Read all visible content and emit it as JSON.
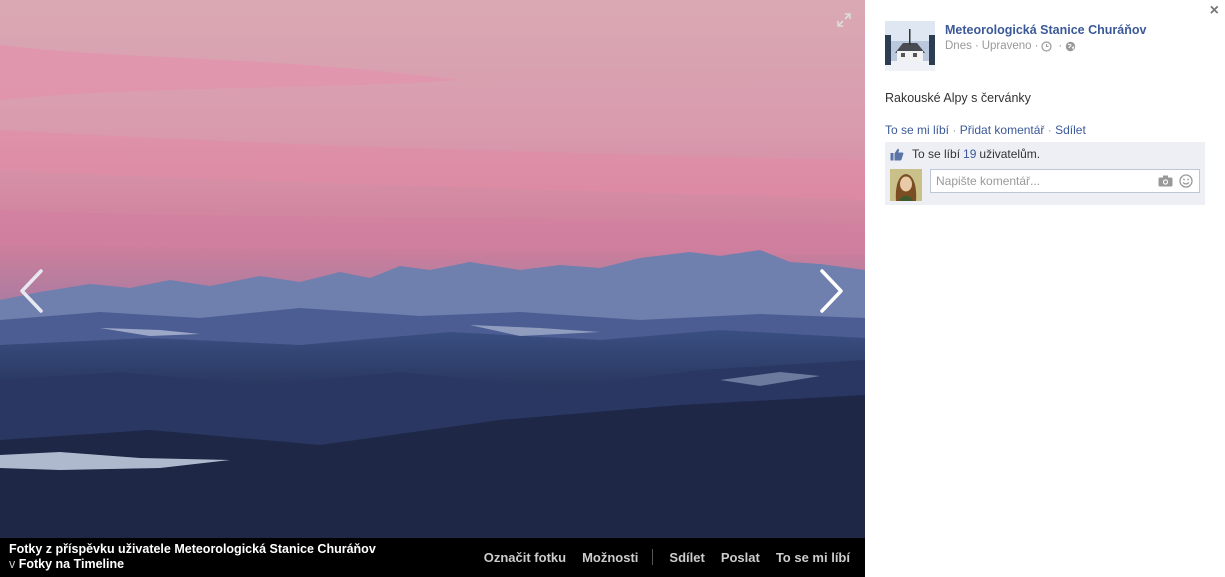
{
  "viewer": {
    "source_title": "Fotky z příspěvku uživatele Meteorologická Stanice Churáňov",
    "source_prefix": "v",
    "source_album": "Fotky na Timeline",
    "actions": {
      "tag": "Označit fotku",
      "options": "Možnosti",
      "share": "Sdílet",
      "send": "Poslat",
      "like": "To se mi líbí"
    },
    "icons": {
      "prev": "chevron-left-icon",
      "next": "chevron-right-icon",
      "expand": "expand-icon"
    }
  },
  "panel": {
    "close": "×",
    "page_name": "Meteorologická Stanice Churáňov",
    "meta": {
      "date": "Dnes",
      "sep1": "·",
      "edited": "Upraveno",
      "sep2": "·",
      "sep3": "·"
    },
    "caption": "Rakouské Alpy s červánky",
    "ufi": {
      "like": "To se mi líbí",
      "sep1": "·",
      "comment": "Přidat komentář",
      "sep2": "·",
      "share": "Sdílet"
    },
    "likes": {
      "prefix": "To se líbí",
      "count": "19",
      "suffix": "uživatelům."
    },
    "comment_placeholder": "Napište komentář..."
  },
  "colors": {
    "link": "#3b5998",
    "ufi_bg": "#edeff4",
    "viewer_bg": "#000000"
  }
}
